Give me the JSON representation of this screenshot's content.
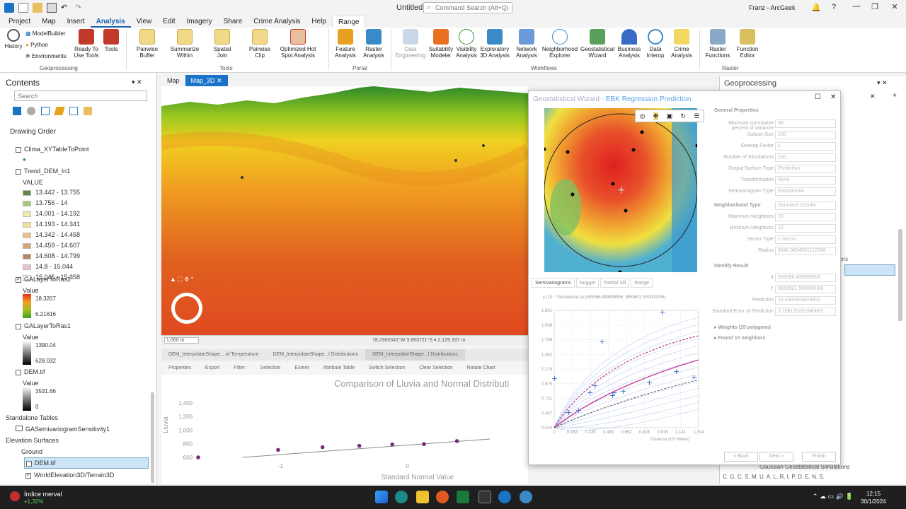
{
  "window": {
    "title": "Untitled",
    "command_search_placeholder": "Command Search (Alt+Q)",
    "user": "Franz - ArcGeek",
    "minimize": "—",
    "restore": "❐",
    "close": "✕"
  },
  "menu": [
    "Project",
    "Map",
    "Insert",
    "Analysis",
    "View",
    "Edit",
    "Imagery",
    "Share",
    "Crime Analysis",
    "Help",
    "Range"
  ],
  "ribbon": {
    "geoprocessing": {
      "label": "Geoprocessing",
      "history": "History",
      "modelbuilder": "ModelBuilder",
      "python": "Python",
      "environments": "Environments",
      "ready_to_use": "Ready To Use Tools",
      "tools": "Tools"
    },
    "tools": {
      "label": "Tools",
      "items": [
        "Pairwise Buffer",
        "Summarize Within",
        "Spatial Join",
        "Pairwise Clip",
        "Optimized Hot Spot Analysis"
      ]
    },
    "portal": {
      "label": "Portal",
      "items": [
        "Feature Analysis",
        "Raster Analysis"
      ]
    },
    "workflows": {
      "label": "Workflows",
      "items": [
        "Data Engineering",
        "Suitability Modeler",
        "Visibility Analysis",
        "Exploratory 3D Analysis",
        "Network Analysis",
        "Neighborhood Explorer",
        "Geostatistical Wizard",
        "Business Analysis",
        "Data Interop",
        "Crime Analysis"
      ]
    },
    "raster": {
      "label": "Raster",
      "items": [
        "Raster Functions",
        "Function Editor"
      ]
    }
  },
  "contents": {
    "title": "Contents",
    "search_placeholder": "Search",
    "drawing_order": "Drawing Order",
    "layer1": "Clima_XYTableToPoint",
    "layer2": "Trend_DEM_ln1",
    "value_label": "VALUE",
    "legend": [
      {
        "label": "13.442 - 13.755",
        "color": "#5a8a3c"
      },
      {
        "label": "13.756 - 14",
        "color": "#a8c87a"
      },
      {
        "label": "14.001 - 14.192",
        "color": "#eeeab0"
      },
      {
        "label": "14.193 - 14.341",
        "color": "#f3dc9e"
      },
      {
        "label": "14.342 - 14.458",
        "color": "#e9c08a"
      },
      {
        "label": "14.459 - 14.607",
        "color": "#d8a47a"
      },
      {
        "label": "14.608 - 14.799",
        "color": "#b8886a"
      },
      {
        "label": "14.8 - 15.044",
        "color": "#e8c0d0"
      },
      {
        "label": "15.045 - 15.358",
        "color": "#ffffff"
      }
    ],
    "layer3": "GALayerToRas2",
    "value2": "Value",
    "l3_max": "18.3207",
    "l3_min": "6.21616",
    "layer4": "GALayerToRas1",
    "value3": "Value",
    "l4_max": "1390.04",
    "l4_min": "628.032",
    "layer5": "DEM.tif",
    "value4": "Value",
    "l5_max": "3531.66",
    "l5_min": "0",
    "standalone": "Standalone Tables",
    "table1": "GASemivariogramSensitivity1",
    "elevation": "Elevation Surfaces",
    "ground": "Ground",
    "surf1": "DEM.tif",
    "surf2": "WorldElevation3D/Terrain3D"
  },
  "map_tabs": [
    "Map",
    "Map_3D"
  ],
  "map_status": {
    "scale": "1,060 m",
    "coords": "78.2305341°W 3.863721°S  ▾  2,129.337 m"
  },
  "bottom_tabs": [
    "DEM_InterpolateShape... of Temperature",
    "DEM_InterpolateShape...l Distributions",
    "DEM_InterpolateShape...l Distributions"
  ],
  "chart_tools": [
    "Properties",
    "Export",
    "Filter:",
    "Selection",
    "Extent",
    "Attribute Table",
    "Switch Selection",
    "Clear Selection",
    "Rotate Chart"
  ],
  "chart_data": {
    "type": "scatter",
    "title": "Comparison of Lluvia and Normal Distributi",
    "xlabel": "Standard Normal Value",
    "ylabel": "Lluvia",
    "y_ticks": [
      "1,400",
      "1,200",
      "1,000",
      "800",
      "600"
    ],
    "x_ticks": [
      "-1",
      "0",
      "1"
    ],
    "points": [
      [
        -1.65,
        600
      ],
      [
        -1.02,
        710
      ],
      [
        -0.67,
        750
      ],
      [
        -0.38,
        770
      ],
      [
        -0.12,
        790
      ],
      [
        0.13,
        795
      ],
      [
        0.39,
        840
      ]
    ],
    "line": [
      [
        -1.3,
        600
      ],
      [
        0.65,
        870
      ]
    ],
    "xlim": [
      -1.65,
      0.95
    ],
    "ylim": [
      590,
      1440
    ]
  },
  "wizard": {
    "title": "Geostatistical Wizard - ",
    "subtitle": "EBK Regression Prediction",
    "tabs": [
      "Semivariograms",
      "Nugget",
      "Partial Sill",
      "Range"
    ],
    "semivar_header": "γ (10⁻¹   Simulations at (699066.499999856, 9559631.500000006)",
    "y_ticks": [
      "1.961",
      "1.669",
      "1.706",
      "1.462",
      "1.219",
      "0.975",
      "0.731",
      "0.487",
      "0.244"
    ],
    "x_ticks": [
      "0",
      "0.163",
      "0.326",
      "0.489",
      "0.652",
      "0.815",
      "0.978",
      "1.141",
      "1.304"
    ],
    "x_label": "Distance (10⁵ Meter)",
    "general_props": "General Properties",
    "props": [
      {
        "label": "Minimum cumulative percent of variance",
        "value": "95"
      },
      {
        "label": "Subset Size",
        "value": "100"
      },
      {
        "label": "Overlap Factor",
        "value": "1"
      },
      {
        "label": "Number of Simulations",
        "value": "100"
      },
      {
        "label": "Output Surface Type",
        "value": "Prediction"
      },
      {
        "label": "Transformation",
        "value": "None"
      },
      {
        "label": "Semivariogram Type",
        "value": "Exponential"
      }
    ],
    "neigh_type_label": "Neighborhood Type",
    "neigh_type": "Standard Circular",
    "neigh_props": [
      {
        "label": "Maximum Neighbors",
        "value": "15"
      },
      {
        "label": "Minimum Neighbors",
        "value": "10"
      },
      {
        "label": "Sector Type",
        "value": "1 Sector"
      },
      {
        "label": "Radius",
        "value": "8940.0404561122066"
      }
    ],
    "identify": "Identify Result",
    "id_props": [
      {
        "label": "X",
        "value": "699066.499999856"
      },
      {
        "label": "Y",
        "value": "9559631.500000006"
      },
      {
        "label": "Prediction",
        "value": "16.4382443624852"
      },
      {
        "label": "Standard Error of Prediction",
        "value": "0.158173291540687"
      }
    ],
    "weights": "Weights (15 polygons)",
    "found": "Found 10 neighbors",
    "back": "< Back",
    "next": "Next >",
    "finish": "Finish"
  },
  "geoprocessing": {
    "title": "Geoprocessing",
    "tail_text": "ers",
    "result": "Gaussian Geostatistical Simulations"
  },
  "taskbar": {
    "news_title": "Índice merval",
    "news_value": "+1,32%",
    "time": "12:15",
    "date": "30/1/2024"
  }
}
